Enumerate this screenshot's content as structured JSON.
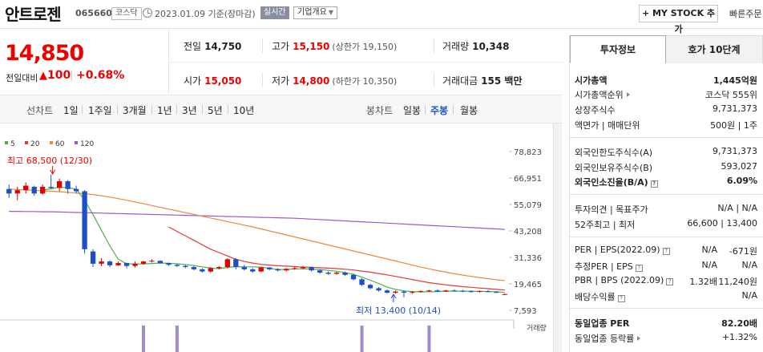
{
  "header": {
    "stock_name": "안트로젠",
    "stock_code": "065660",
    "market": "코스닥",
    "date": "2023.01.09 기준(장마감)",
    "realtime": "실시간",
    "company_info": "기업개요",
    "mystock_button": "+ MY STOCK 추가",
    "quick_order": "빠른주문"
  },
  "price": {
    "current": "14,850",
    "diff_label": "전일대비",
    "diff_value": "100",
    "diff_rate": "+0.68%"
  },
  "quote": {
    "prev_close_label": "전일",
    "prev_close": "14,750",
    "high_label": "고가",
    "high": "15,150",
    "upper_limit": "(상한가 19,150)",
    "volume_label": "거래량",
    "volume": "10,348",
    "open_label": "시가",
    "open": "15,050",
    "low_label": "저가",
    "low": "14,800",
    "lower_limit": "(하한가 10,350)",
    "amount_label": "거래대금",
    "amount": "155 백만"
  },
  "period_bar": {
    "line_chart_label": "선차트",
    "line_periods": [
      "1일",
      "1주일",
      "3개월",
      "1년",
      "3년",
      "5년",
      "10년"
    ],
    "candle_chart_label": "봉차트",
    "candle_periods": [
      "일봉",
      "주봉",
      "월봉"
    ],
    "active_candle": "주봉"
  },
  "sidebar": {
    "tab_invest": "투자정보",
    "tab_orderbook": "호가 10단계",
    "market_cap_label": "시가총액",
    "market_cap": "1,445억원",
    "market_cap_rank_label": "시가총액순위",
    "market_cap_rank": "코스닥 555위",
    "shares_label": "상장주식수",
    "shares": "9,731,373",
    "par_label": "액면가 | 매매단위",
    "par": "500원 | 1주",
    "foreign_limit_label": "외국인한도주식수(A)",
    "foreign_limit": "9,731,373",
    "foreign_hold_label": "외국인보유주식수(B)",
    "foreign_hold": "593,027",
    "foreign_ratio_label": "외국인소진율(B/A)",
    "foreign_ratio": "6.09%",
    "opinion_label": "투자의견 | 목표주가",
    "opinion": "N/A | N/A",
    "w52_label": "52주최고 | 최저",
    "w52": "66,600 | 13,400",
    "per_label": "PER | EPS(2022.09)",
    "per": "N/A",
    "eps": "-671원",
    "est_per_label": "추정PER | EPS",
    "est_per": "N/A",
    "est_eps": "N/A",
    "pbr_label": "PBR | BPS (2022.09)",
    "pbr": "1.32배",
    "bps": "11,240원",
    "div_label": "배당수익률",
    "div": "N/A",
    "sector_per_label": "동일업종 PER",
    "sector_per": "82.20배",
    "sector_rate_label": "동일업종 등락률",
    "sector_rate": "+1.32%"
  },
  "colors": {
    "up": "#e00000",
    "down": "#1d50c8",
    "ma5": "#4caf50",
    "ma20": "#e53935",
    "ma60": "#f0883a",
    "ma120": "#9c5ac8"
  },
  "chart_data": {
    "type": "candlestick",
    "legend": [
      {
        "name": "5",
        "color": "#4caf50"
      },
      {
        "name": "20",
        "color": "#e53935"
      },
      {
        "name": "60",
        "color": "#f0883a"
      },
      {
        "name": "120",
        "color": "#9c5ac8"
      }
    ],
    "y_ticks": [
      "78,823",
      "66,951",
      "55,079",
      "43,208",
      "31,336",
      "19,465",
      "7,593"
    ],
    "ylim": [
      7593,
      78823
    ],
    "annotation_high": "최고 68,500 (12/30)",
    "annotation_low": "최저 13,400 (10/14)",
    "volume_label": "거래량",
    "candles": [
      [
        62000,
        64000,
        58000,
        60000
      ],
      [
        60000,
        63000,
        57000,
        61500
      ],
      [
        61500,
        65000,
        60000,
        63500
      ],
      [
        63000,
        63500,
        59000,
        60000
      ],
      [
        60000,
        64000,
        59500,
        63000
      ],
      [
        63000,
        68500,
        62000,
        62500
      ],
      [
        62500,
        66600,
        61000,
        65500
      ],
      [
        65500,
        66000,
        60000,
        62000
      ],
      [
        62000,
        63500,
        60000,
        61000
      ],
      [
        61000,
        61500,
        33000,
        35000
      ],
      [
        34000,
        35000,
        27000,
        28500
      ],
      [
        28500,
        31000,
        27500,
        29500
      ],
      [
        29500,
        30000,
        27000,
        27800
      ],
      [
        27800,
        29500,
        27500,
        28800
      ],
      [
        28800,
        29000,
        26500,
        27500
      ],
      [
        27500,
        29500,
        26800,
        28500
      ],
      [
        28500,
        29800,
        28000,
        29500
      ],
      [
        29500,
        30500,
        29000,
        29800
      ],
      [
        29800,
        30000,
        28500,
        28800
      ],
      [
        28800,
        29000,
        27500,
        28000
      ],
      [
        28000,
        28500,
        27000,
        27500
      ],
      [
        27500,
        28000,
        26500,
        27000
      ],
      [
        27000,
        27500,
        25500,
        26000
      ],
      [
        26000,
        26500,
        24500,
        25000
      ],
      [
        25000,
        27000,
        24500,
        26500
      ],
      [
        26500,
        27500,
        26000,
        27000
      ],
      [
        27000,
        31000,
        26500,
        30500
      ],
      [
        30500,
        31000,
        26000,
        27000
      ],
      [
        27000,
        28000,
        25500,
        26000
      ],
      [
        26000,
        26500,
        24500,
        25000
      ],
      [
        25000,
        27000,
        24800,
        26800
      ],
      [
        26800,
        27000,
        25500,
        26000
      ],
      [
        26000,
        26500,
        25000,
        25500
      ],
      [
        25500,
        26500,
        25000,
        26200
      ],
      [
        26200,
        27000,
        25800,
        26500
      ],
      [
        26500,
        27500,
        26000,
        27000
      ],
      [
        27000,
        27200,
        25000,
        25500
      ],
      [
        25500,
        26000,
        24000,
        24500
      ],
      [
        24500,
        25000,
        23500,
        24000
      ],
      [
        24000,
        24800,
        23500,
        24500
      ],
      [
        24500,
        25000,
        23000,
        23500
      ],
      [
        23500,
        24000,
        21000,
        21500
      ],
      [
        21500,
        22000,
        18500,
        19000
      ],
      [
        19000,
        19500,
        17000,
        17500
      ],
      [
        17500,
        18000,
        16000,
        16500
      ],
      [
        16500,
        17000,
        15000,
        15500
      ],
      [
        15500,
        16500,
        15000,
        16000
      ],
      [
        16000,
        16500,
        13400,
        15500
      ],
      [
        15500,
        16200,
        15000,
        15800
      ],
      [
        15800,
        16500,
        15500,
        16200
      ],
      [
        16200,
        16800,
        15800,
        16500
      ],
      [
        16500,
        17000,
        15800,
        16000
      ],
      [
        16000,
        16800,
        15800,
        16500
      ],
      [
        16500,
        17000,
        16000,
        16300
      ],
      [
        16300,
        16800,
        15800,
        16100
      ],
      [
        16100,
        16500,
        15600,
        15900
      ],
      [
        15900,
        16500,
        15600,
        16200
      ],
      [
        16200,
        16600,
        15700,
        15800
      ],
      [
        15800,
        16200,
        15400,
        15600
      ],
      [
        14750,
        15150,
        14800,
        14850
      ]
    ],
    "ma5": [
      null,
      null,
      null,
      null,
      61500,
      62100,
      62900,
      62600,
      62000,
      57000,
      50500,
      43500,
      36500,
      30500,
      28500,
      28400,
      28400,
      28600,
      28800,
      28700,
      28500,
      28100,
      27700,
      27100,
      26500,
      26300,
      26800,
      27200,
      27100,
      27100,
      27000,
      26400,
      25900,
      25900,
      26200,
      26200,
      26100,
      25900,
      25500,
      25100,
      24500,
      23700,
      22500,
      21100,
      19600,
      18000,
      17000,
      16300,
      16000,
      15900,
      15900,
      16000,
      16200,
      16200,
      16200,
      16200,
      16100,
      16000,
      15900,
      15600
    ],
    "ma20": [
      null,
      null,
      null,
      null,
      null,
      null,
      null,
      null,
      null,
      null,
      null,
      null,
      null,
      null,
      null,
      null,
      null,
      null,
      null,
      45000,
      43000,
      41000,
      39000,
      37000,
      35000,
      33500,
      32000,
      30500,
      29500,
      28800,
      28200,
      27900,
      27600,
      27400,
      27200,
      27000,
      26900,
      26700,
      26500,
      26300,
      26000,
      25700,
      25200,
      24700,
      24100,
      23500,
      22800,
      22100,
      21400,
      20700,
      20000,
      19500,
      19000,
      18600,
      18200,
      17900,
      17600,
      17300,
      17000,
      16700
    ],
    "ma60": [
      62000,
      61800,
      61600,
      61400,
      61200,
      61000,
      60800,
      60500,
      60200,
      59900,
      59500,
      59000,
      58400,
      57700,
      57000,
      56200,
      55400,
      54600,
      53800,
      53000,
      52200,
      51400,
      50600,
      49800,
      49000,
      48200,
      47400,
      46600,
      45800,
      45000,
      44100,
      43200,
      42300,
      41400,
      40500,
      39600,
      38700,
      37800,
      36900,
      36000,
      35100,
      34200,
      33300,
      32400,
      31500,
      30600,
      29700,
      28800,
      27900,
      27000,
      26200,
      25400,
      24700,
      24000,
      23400,
      22800,
      22300,
      21800,
      21300,
      20900
    ],
    "ma120": [
      52000,
      52000,
      51900,
      51900,
      51800,
      51800,
      51700,
      51600,
      51500,
      51400,
      51300,
      51200,
      51100,
      51000,
      50900,
      50800,
      50700,
      50600,
      50500,
      50400,
      50300,
      50200,
      50100,
      50000,
      49900,
      49800,
      49700,
      49600,
      49500,
      49400,
      49300,
      49200,
      49100,
      49000,
      48900,
      48700,
      48500,
      48300,
      48100,
      47900,
      47700,
      47500,
      47300,
      47100,
      46900,
      46700,
      46500,
      46300,
      46100,
      45900,
      45700,
      45500,
      45300,
      45100,
      44900,
      44700,
      44500,
      44300,
      44100,
      43900
    ]
  }
}
